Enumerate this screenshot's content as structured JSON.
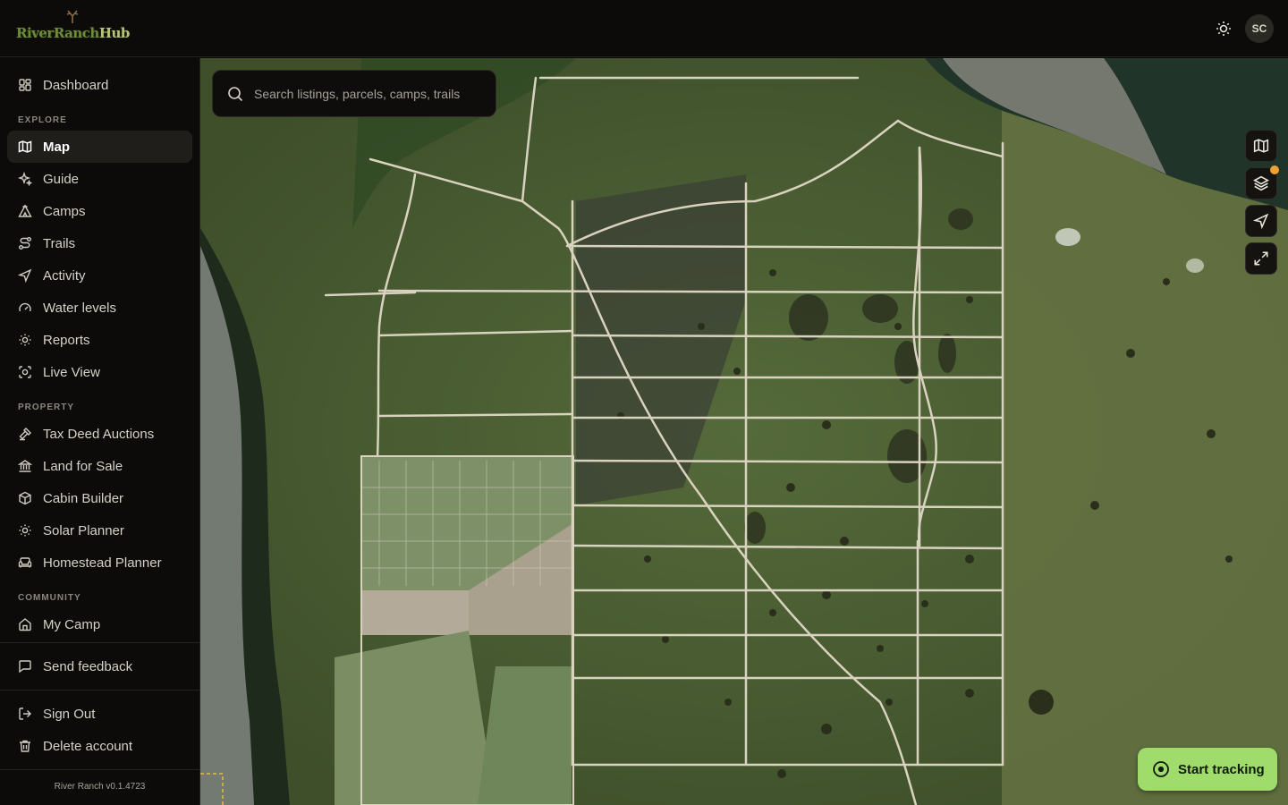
{
  "app": {
    "logo_text_main": "RiverRanch",
    "logo_text_hub": "Hub",
    "user_initials": "SC",
    "version": "River Ranch v0.1.4723"
  },
  "search": {
    "placeholder": "Search listings, parcels, camps, trails"
  },
  "sidebar": {
    "top_item": {
      "label": "Dashboard",
      "icon": "dashboard-icon"
    },
    "sections": [
      {
        "label": "EXPLORE",
        "items": [
          {
            "label": "Map",
            "icon": "map-icon",
            "active": true
          },
          {
            "label": "Guide",
            "icon": "sparkle-icon"
          },
          {
            "label": "Camps",
            "icon": "tent-icon"
          },
          {
            "label": "Trails",
            "icon": "route-icon"
          },
          {
            "label": "Activity",
            "icon": "navigation-icon"
          },
          {
            "label": "Water levels",
            "icon": "gauge-icon"
          },
          {
            "label": "Reports",
            "icon": "sun-icon"
          },
          {
            "label": "Live View",
            "icon": "camera-icon"
          }
        ]
      },
      {
        "label": "PROPERTY",
        "items": [
          {
            "label": "Tax Deed Auctions",
            "icon": "gavel-icon"
          },
          {
            "label": "Land for Sale",
            "icon": "bank-icon"
          },
          {
            "label": "Cabin Builder",
            "icon": "box-icon"
          },
          {
            "label": "Solar Planner",
            "icon": "sun-icon"
          },
          {
            "label": "Homestead Planner",
            "icon": "sofa-icon"
          }
        ]
      },
      {
        "label": "COMMUNITY",
        "items": [
          {
            "label": "My Camp",
            "icon": "home-icon"
          }
        ]
      }
    ],
    "feedback": {
      "label": "Send feedback",
      "icon": "message-icon"
    },
    "account": [
      {
        "label": "Sign Out",
        "icon": "logout-icon"
      },
      {
        "label": "Delete account",
        "icon": "trash-icon"
      }
    ]
  },
  "map_controls": [
    {
      "name": "basemap-button",
      "icon": "map-icon"
    },
    {
      "name": "layers-button",
      "icon": "layers-icon",
      "has_badge": true
    },
    {
      "name": "locate-button",
      "icon": "navigation-icon"
    },
    {
      "name": "fullscreen-button",
      "icon": "expand-icon"
    }
  ],
  "tracking": {
    "label": "Start tracking",
    "icon": "target-icon"
  },
  "colors": {
    "background": "#0c0b09",
    "accent_green": "#9fdc6b",
    "badge_orange": "#f0a030",
    "active_item_bg": "#1f1e1a"
  }
}
